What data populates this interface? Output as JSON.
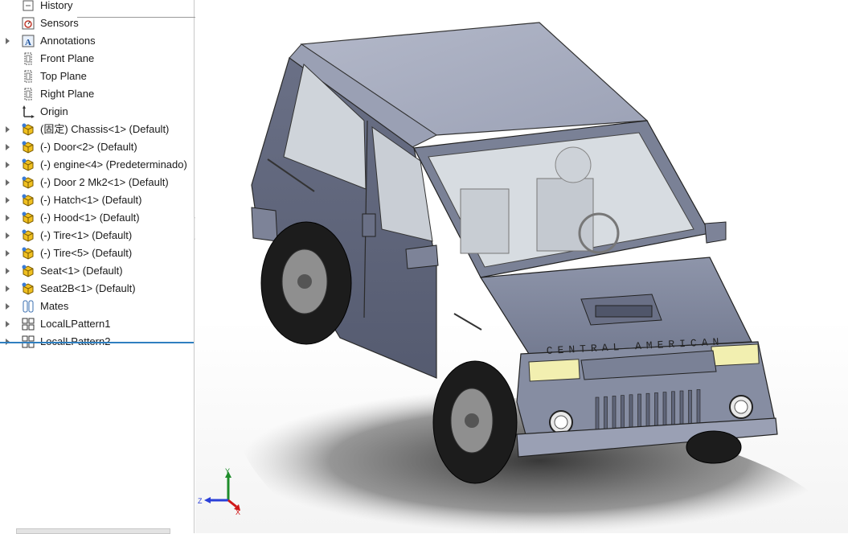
{
  "feature_tree": {
    "items": [
      {
        "label": "History",
        "icon": "history-icon",
        "expandable": false
      },
      {
        "label": "Sensors",
        "icon": "sensors-icon",
        "expandable": false
      },
      {
        "label": "Annotations",
        "icon": "annotations-icon",
        "expandable": true
      },
      {
        "label": "Front Plane",
        "icon": "plane-icon",
        "expandable": false
      },
      {
        "label": "Top Plane",
        "icon": "plane-icon",
        "expandable": false
      },
      {
        "label": "Right Plane",
        "icon": "plane-icon",
        "expandable": false
      },
      {
        "label": "Origin",
        "icon": "origin-icon",
        "expandable": false
      },
      {
        "label": "(固定) Chassis<1> (Default)",
        "icon": "part-icon",
        "expandable": true
      },
      {
        "label": "(-) Door<2> (Default)",
        "icon": "part-icon",
        "expandable": true
      },
      {
        "label": "(-) engine<4> (Predeterminado)",
        "icon": "part-icon",
        "expandable": true
      },
      {
        "label": "(-) Door 2 Mk2<1> (Default)",
        "icon": "part-icon",
        "expandable": true
      },
      {
        "label": "(-) Hatch<1> (Default)",
        "icon": "part-icon",
        "expandable": true
      },
      {
        "label": "(-) Hood<1> (Default)",
        "icon": "part-icon",
        "expandable": true
      },
      {
        "label": "(-) Tire<1> (Default)",
        "icon": "part-icon",
        "expandable": true
      },
      {
        "label": "(-) Tire<5> (Default)",
        "icon": "part-icon",
        "expandable": true
      },
      {
        "label": "Seat<1> (Default)",
        "icon": "part-icon",
        "expandable": true
      },
      {
        "label": "Seat2B<1> (Default)",
        "icon": "part-icon",
        "expandable": true
      },
      {
        "label": "Mates",
        "icon": "mates-icon",
        "expandable": true
      },
      {
        "label": "LocalLPattern1",
        "icon": "pattern-icon",
        "expandable": true
      },
      {
        "label": "LocalLPattern2",
        "icon": "pattern-icon",
        "expandable": true
      }
    ]
  },
  "graphics": {
    "grille_text": "CENTRAL AMERICAN",
    "triad": {
      "x_label": "X",
      "y_label": "Y",
      "z_label": "Z"
    }
  },
  "colors": {
    "body": "#8b92a8",
    "body_dark": "#5e6478",
    "roof": "#a5abbf",
    "glass": "#d4dadf",
    "tire": "#1c1c1c",
    "hub": "#8f8f8f",
    "headlight": "#f2efb0",
    "shadow": "#3a3a3a",
    "rollback": "#2f7fc0",
    "part_icon": "#f0c020"
  }
}
